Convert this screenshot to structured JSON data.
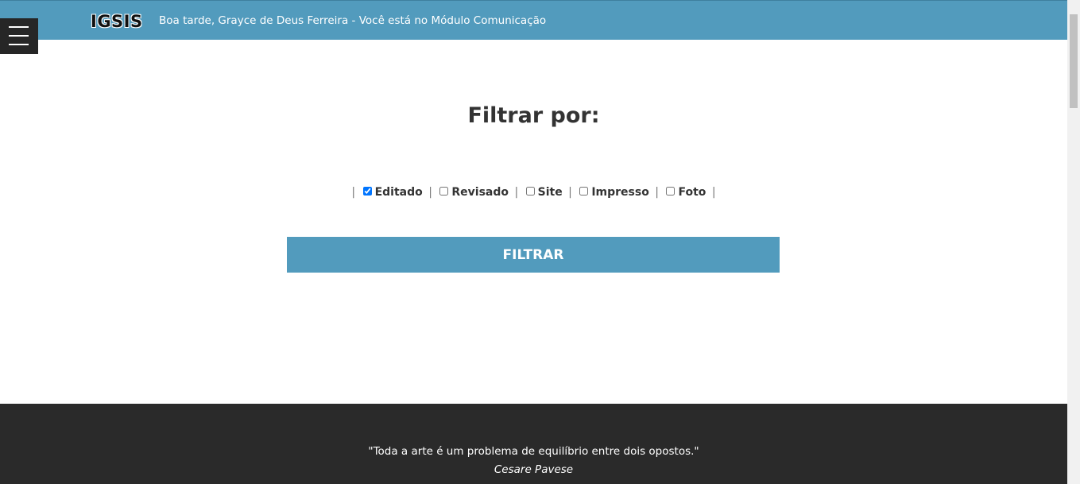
{
  "header": {
    "logo": "IGSIS",
    "greeting": "Boa tarde, Grayce de Deus Ferreira - Você está no Módulo Comunicação"
  },
  "filter": {
    "title": "Filtrar por:",
    "separator": "|",
    "options": [
      {
        "label": "Editado",
        "checked": true
      },
      {
        "label": "Revisado",
        "checked": false
      },
      {
        "label": "Site",
        "checked": false
      },
      {
        "label": "Impresso",
        "checked": false
      },
      {
        "label": "Foto",
        "checked": false
      }
    ],
    "button_label": "FILTRAR"
  },
  "footer": {
    "quote": "\"Toda a arte é um problema de equilíbrio entre dois opostos.\"",
    "author": "Cesare Pavese"
  },
  "colors": {
    "primary": "#529bbd",
    "dark": "#2a2a2a",
    "menu": "#262626"
  },
  "icons": {
    "menu": "hamburger-menu-icon"
  }
}
